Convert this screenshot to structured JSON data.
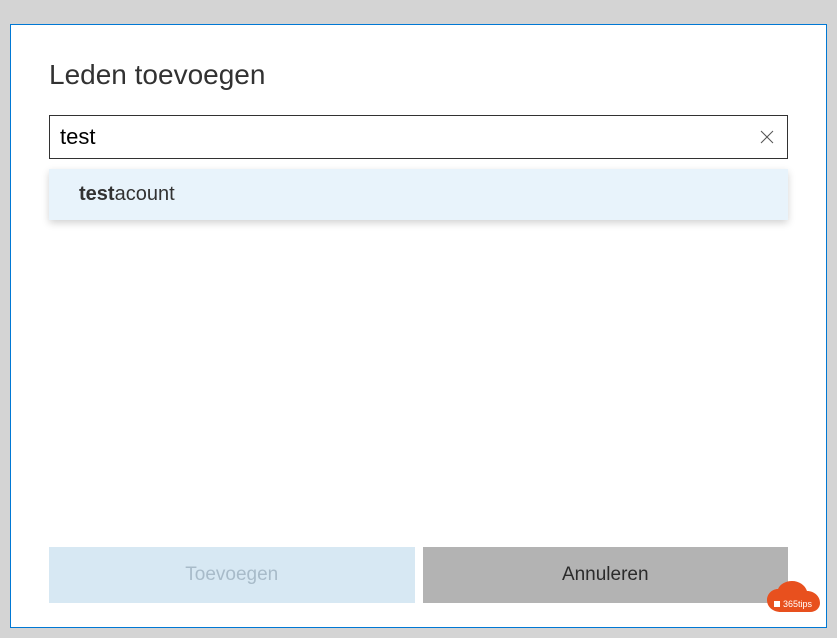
{
  "dialog": {
    "title": "Leden toevoegen"
  },
  "search": {
    "value": "test",
    "clear_icon": "close"
  },
  "suggestions": [
    {
      "match": "test",
      "rest": "acount"
    }
  ],
  "buttons": {
    "primary": "Toevoegen",
    "secondary": "Annuleren"
  },
  "watermark": {
    "label": "365tips",
    "icon": "office-logo"
  },
  "colors": {
    "dialog_border": "#0078d4",
    "watermark": "#e8501e",
    "primary_btn_bg": "#d7e8f3",
    "secondary_btn_bg": "#b3b3b3",
    "suggestion_highlight": "#e8f3fb"
  }
}
